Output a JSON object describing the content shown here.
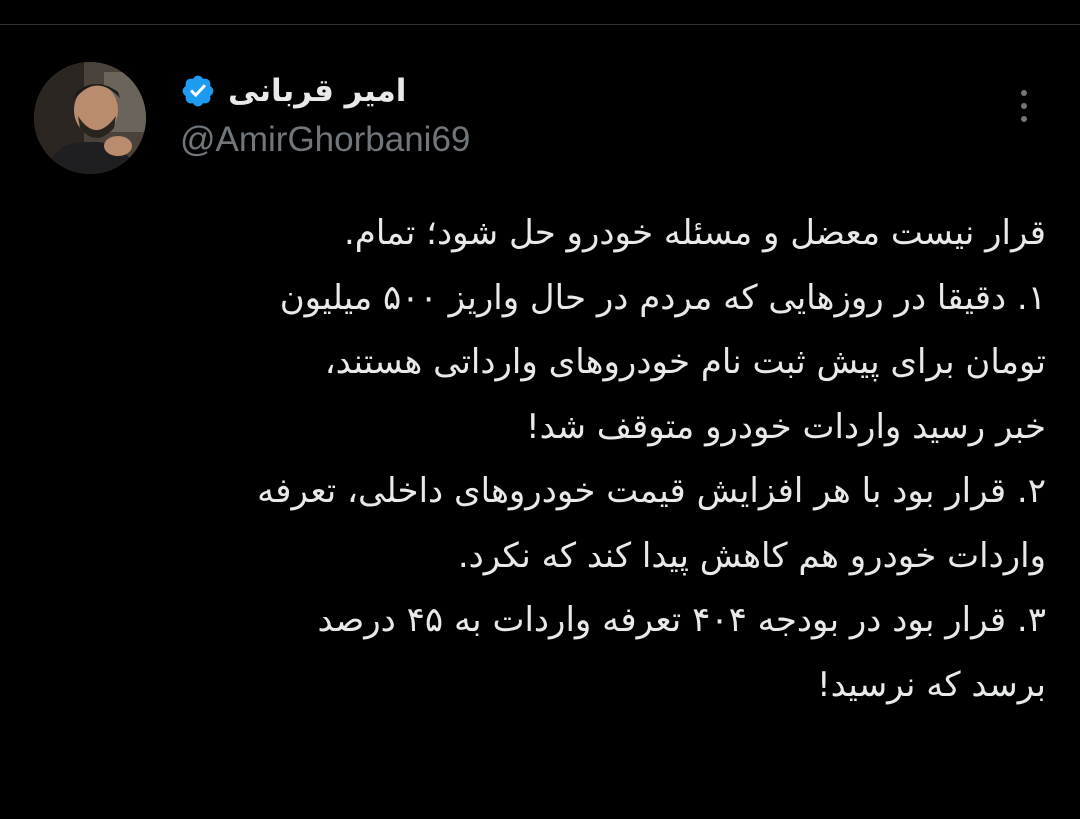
{
  "author": {
    "display_name": "امیر قربانی",
    "handle": "@AmirGhorbani69",
    "verified": true,
    "verified_color": "#1d9bf0",
    "avatar": "profile-photo"
  },
  "actions": {
    "more_icon": "more-vertical-icon"
  },
  "tweet": {
    "lines": [
      "قرار نیست معضل و مسئله خودرو حل شود؛ تمام.",
      "۱. دقیقا در روزهایی که مردم در حال واریز ۵۰۰ میلیون",
      "تومان برای پیش ثبت نام خودروهای وارداتی هستند،",
      "خبر رسید واردات خودرو متوقف شد!",
      "۲. قرار بود با هر افزایش قیمت خودروهای داخلی، تعرفه",
      "واردات خودرو هم کاهش پیدا کند که نکرد.",
      "۳. قرار بود در بودجه ۴۰۴ تعرفه واردات به ۴۵ درصد",
      "برسد که نرسید!"
    ]
  },
  "theme": {
    "background": "#000000",
    "text": "#e7e9ea",
    "secondary_text": "#71767b",
    "divider": "#2f3336"
  }
}
